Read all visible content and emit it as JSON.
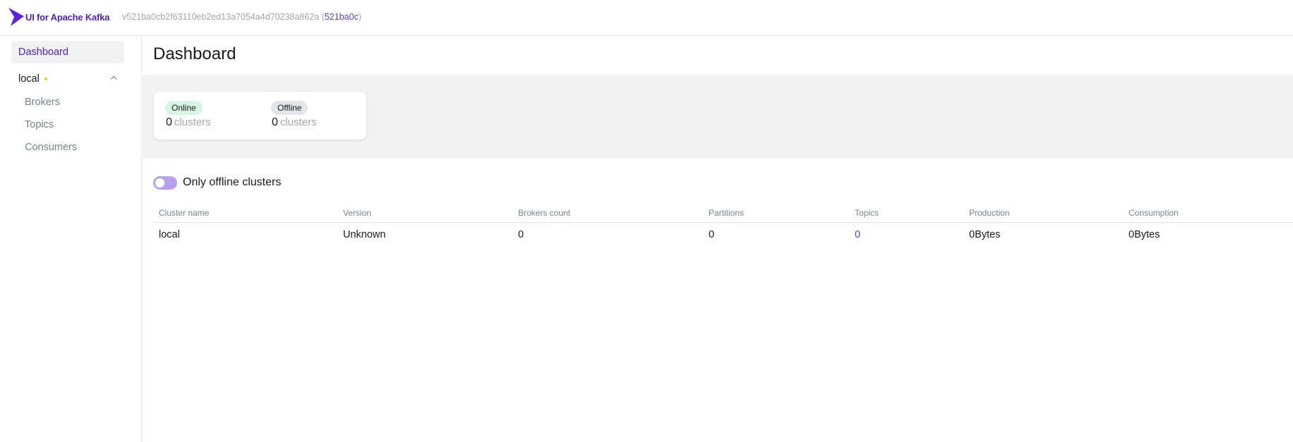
{
  "header": {
    "brand": "UI for Apache Kafka",
    "version_prefix": "v521ba0cb2f63110eb2ed13a7054a4d70238a862a (",
    "commit": "521ba0c",
    "version_suffix": ")",
    "brand_color": "#4c1fc0"
  },
  "sidebar": {
    "dashboard_label": "Dashboard",
    "cluster_name": "local",
    "cluster_status_color": "#ffc107",
    "items": [
      {
        "label": "Brokers"
      },
      {
        "label": "Topics"
      },
      {
        "label": "Consumers"
      }
    ]
  },
  "main": {
    "title": "Dashboard",
    "stats": {
      "online_label": "Online",
      "online_count": "0",
      "offline_label": "Offline",
      "offline_count": "0",
      "unit": "clusters"
    },
    "toggle_label": "Only offline clusters",
    "table": {
      "headers": [
        "Cluster name",
        "Version",
        "Brokers count",
        "Partitions",
        "Topics",
        "Production",
        "Consumption"
      ],
      "rows": [
        [
          "local",
          "Unknown",
          "0",
          "0",
          "0",
          "0Bytes",
          "0Bytes"
        ]
      ]
    }
  }
}
